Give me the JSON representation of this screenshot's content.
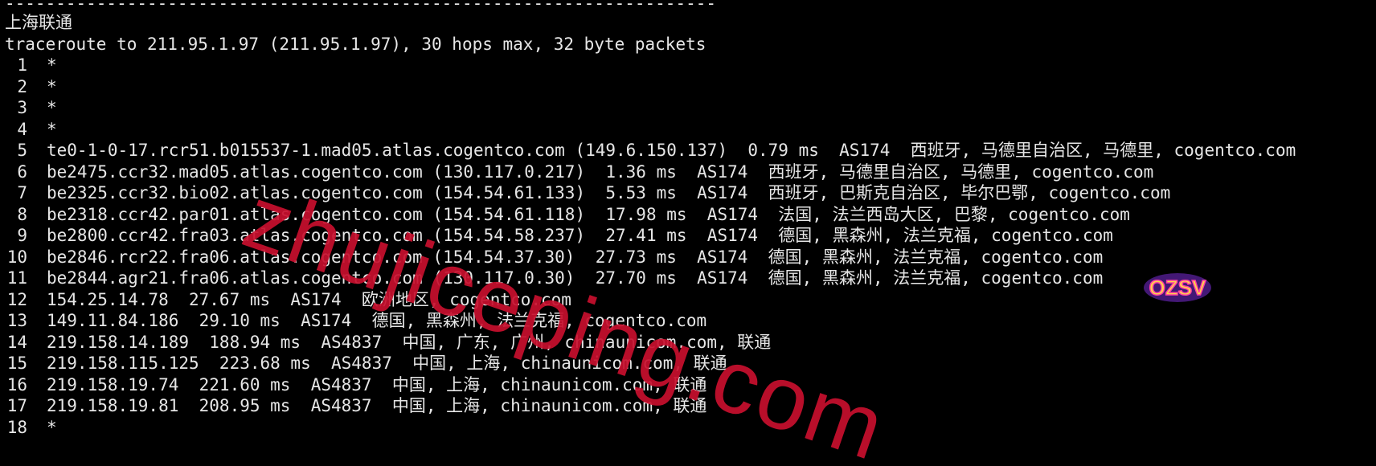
{
  "divider": "----------------------------------------------------------------------",
  "heading": "上海联通",
  "command_line": "traceroute to 211.95.1.97 (211.95.1.97), 30 hops max, 32 byte packets",
  "hops": [
    {
      "num": "1",
      "text": "*"
    },
    {
      "num": "2",
      "text": "*"
    },
    {
      "num": "3",
      "text": "*"
    },
    {
      "num": "4",
      "text": "*"
    },
    {
      "num": "5",
      "text": "te0-1-0-17.rcr51.b015537-1.mad05.atlas.cogentco.com (149.6.150.137)  0.79 ms  AS174  西班牙, 马德里自治区, 马德里, cogentco.com"
    },
    {
      "num": "6",
      "text": "be2475.ccr32.mad05.atlas.cogentco.com (130.117.0.217)  1.36 ms  AS174  西班牙, 马德里自治区, 马德里, cogentco.com"
    },
    {
      "num": "7",
      "text": "be2325.ccr32.bio02.atlas.cogentco.com (154.54.61.133)  5.53 ms  AS174  西班牙, 巴斯克自治区, 毕尔巴鄂, cogentco.com"
    },
    {
      "num": "8",
      "text": "be2318.ccr42.par01.atlas.cogentco.com (154.54.61.118)  17.98 ms  AS174  法国, 法兰西岛大区, 巴黎, cogentco.com"
    },
    {
      "num": "9",
      "text": "be2800.ccr42.fra03.atlas.cogentco.com (154.54.58.237)  27.41 ms  AS174  德国, 黑森州, 法兰克福, cogentco.com"
    },
    {
      "num": "10",
      "text": "be2846.rcr22.fra06.atlas.cogentco.com (154.54.37.30)  27.73 ms  AS174  德国, 黑森州, 法兰克福, cogentco.com"
    },
    {
      "num": "11",
      "text": "be2844.agr21.fra06.atlas.cogentco.com (130.117.0.30)  27.70 ms  AS174  德国, 黑森州, 法兰克福, cogentco.com"
    },
    {
      "num": "12",
      "text": "154.25.14.78  27.67 ms  AS174  欧洲地区, cogentco.com"
    },
    {
      "num": "13",
      "text": "149.11.84.186  29.10 ms  AS174  德国, 黑森州, 法兰克福, cogentco.com"
    },
    {
      "num": "14",
      "text": "219.158.14.189  188.94 ms  AS4837  中国, 广东, 广州, chinaunicom.com, 联通"
    },
    {
      "num": "15",
      "text": "219.158.115.125  223.68 ms  AS4837  中国, 上海, chinaunicom.com, 联通"
    },
    {
      "num": "16",
      "text": "219.158.19.74  221.60 ms  AS4837  中国, 上海, chinaunicom.com, 联通"
    },
    {
      "num": "17",
      "text": "219.158.19.81  208.95 ms  AS4837  中国, 上海, chinaunicom.com, 联通"
    },
    {
      "num": "18",
      "text": "*"
    }
  ],
  "watermark": "zhujiceping.com",
  "badge": "OZSV",
  "colors": {
    "background": "#000000",
    "text": "#e6e6e6",
    "watermark": "#c8102e"
  }
}
